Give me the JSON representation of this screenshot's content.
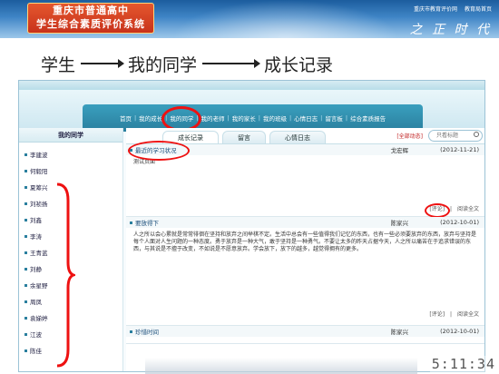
{
  "banner": {
    "logo_line1": "重庆市普通高中",
    "logo_line2": "学生综合素质评价系统",
    "links": [
      "重庆市教育评价网",
      "教育局首页"
    ],
    "motto": "之 正 时 代"
  },
  "flow": {
    "step1": "学生",
    "step2": "我的同学",
    "step3": "成长记录"
  },
  "nav": {
    "items": [
      "首页",
      "我的成长",
      "我的同学",
      "我的老师",
      "我的家长",
      "我的班级",
      "心情日志",
      "留言板",
      "综合素质报告"
    ],
    "active": "我的同学"
  },
  "sidebar": {
    "title": "我的同学",
    "items": [
      "李建波",
      "何毅阳",
      "夏筹兴",
      "刘祯扬",
      "刘鑫",
      "李涛",
      "王青蓝",
      "刘静",
      "余星野",
      "周凤",
      "袁娣婷",
      "江波",
      "陈佳"
    ]
  },
  "tabs": {
    "items": [
      "成长记录",
      "留言",
      "心情日志"
    ],
    "all_updates": "[全部动态]",
    "search_placeholder": "只看标题"
  },
  "posts": [
    {
      "title": "最近的学习状况",
      "author": "戈宏辉",
      "date": "(2012-11-21)",
      "body": "测试页面",
      "comment": "[评论]",
      "read_more": "阅读全文"
    },
    {
      "title": "要放得下",
      "author": "陈家兴",
      "date": "(2012-10-01)",
      "body": "人之所以会心累就是常常徘徊在坚持和放弃之间举棋不定。生活中总会有一些值得我们记忆的东西，也有一些必须要放弃的东西，放弃与坚持是每个人面对人生问题的一种态度。勇于放弃是一种大气，敢于坚持是一种勇气。不要让太多的昨天占据今天，人之所以痛苦在于追求错误的东西，与其说是不擅于改变，不如说是不愿意放弃。学会放下，放下的越多，越觉得拥有的更多。",
      "comment": "[评论]",
      "read_more": "阅读全文"
    },
    {
      "title": "珍惜时间",
      "author": "陈家兴",
      "date": "(2012-10-01)"
    }
  ],
  "clock": "5:11:34"
}
